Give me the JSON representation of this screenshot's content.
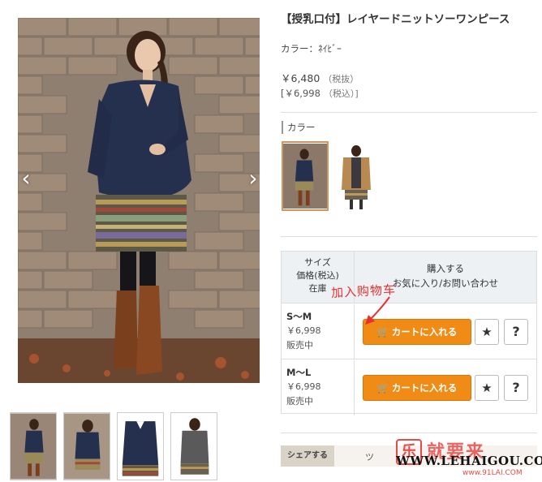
{
  "product": {
    "title": "【授乳口付】レイヤードニットソーワンピース",
    "color_line": "カラー：ﾈｲﾋﾞｰ",
    "price_excl": "￥6,480",
    "price_excl_tax": "（税抜）",
    "price_incl": "[￥6,998",
    "price_incl_tax": "（税込）]"
  },
  "gallery": {
    "prev_glyph": "‹",
    "next_glyph": "›",
    "thumb_count": 4
  },
  "color_section": {
    "label": "カラー"
  },
  "size_table": {
    "head_left_1": "サイズ",
    "head_left_2": "価格(税込)",
    "head_left_3": "在庫",
    "head_right_1": "購入する",
    "head_right_2": "お気に入り/お問い合わせ",
    "rows": [
      {
        "size": "S～M",
        "price": "￥6,998",
        "stock": "販売中",
        "cart_label": "カートに入れる"
      },
      {
        "size": "M～L",
        "price": "￥6,998",
        "stock": "販売中",
        "cart_label": "カートに入れる"
      }
    ],
    "star_glyph": "★",
    "question_glyph": "?"
  },
  "annotation": {
    "text": "加入购物车"
  },
  "share": {
    "button_label": "シェアする",
    "next_text": "ツ"
  },
  "watermark": {
    "logo": "乐",
    "cn": "就要来",
    "url": "WWW.LEHAIGOU.COM",
    "sub": "www.91LAI.COM"
  },
  "colors": {
    "accent_orange": "#f08c16",
    "annotation_red": "#e83030",
    "table_head_bg": "#eef1f4"
  },
  "icons": [
    "chevron-left-icon",
    "chevron-right-icon",
    "cart-icon",
    "star-icon",
    "question-icon"
  ]
}
